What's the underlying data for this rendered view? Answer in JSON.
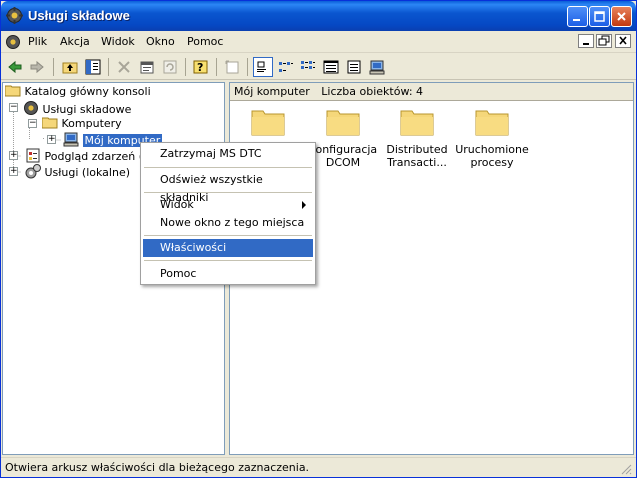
{
  "window": {
    "title": "Usługi składowe"
  },
  "menu": [
    "Plik",
    "Akcja",
    "Widok",
    "Okno",
    "Pomoc"
  ],
  "mdi_controls": [
    "minimize",
    "restore",
    "close"
  ],
  "toolbar_icons": [
    "back-icon",
    "forward-icon",
    "up-icon",
    "show-hide-tree-icon",
    "delete-icon",
    "properties-icon",
    "refresh-icon",
    "help-icon",
    "new-window-icon",
    "large-icons-icon",
    "small-icons-icon",
    "list-icon",
    "details-icon",
    "computer-icon"
  ],
  "tree": {
    "header": "Katalog główny konsoli",
    "items": [
      {
        "label": "Usługi składowe",
        "level": 1,
        "expander": "−"
      },
      {
        "label": "Komputery",
        "level": 2,
        "expander": "−"
      },
      {
        "label": "Mój komputer",
        "level": 3,
        "expander": "+",
        "selected": true
      },
      {
        "label": "Podgląd zdarzeń (lok",
        "level": 1,
        "expander": "+"
      },
      {
        "label": "Usługi (lokalne)",
        "level": 1,
        "expander": "+"
      }
    ]
  },
  "right": {
    "title": "Mój komputer",
    "count_label": "Liczba obiektów: 4",
    "icons": [
      {
        "line1": "",
        "line2": ""
      },
      {
        "line1": "Konfiguracja",
        "line2": "DCOM"
      },
      {
        "line1": "Distributed",
        "line2": "Transacti..."
      },
      {
        "line1": "Uruchomione",
        "line2": "procesy"
      }
    ]
  },
  "context_menu": {
    "items": [
      "Zatrzymaj MS DTC",
      "Odśwież wszystkie składniki",
      "Widok",
      "Nowe okno z tego miejsca",
      "Właściwości",
      "Pomoc"
    ],
    "highlighted": "Właściwości"
  },
  "status": {
    "text": "Otwiera arkusz właściwości dla bieżącego zaznaczenia."
  },
  "colors": {
    "titlebar": "#0a56d0",
    "highlight": "#316ac5",
    "folder": "#f5d77a",
    "chrome": "#ece9d8"
  }
}
